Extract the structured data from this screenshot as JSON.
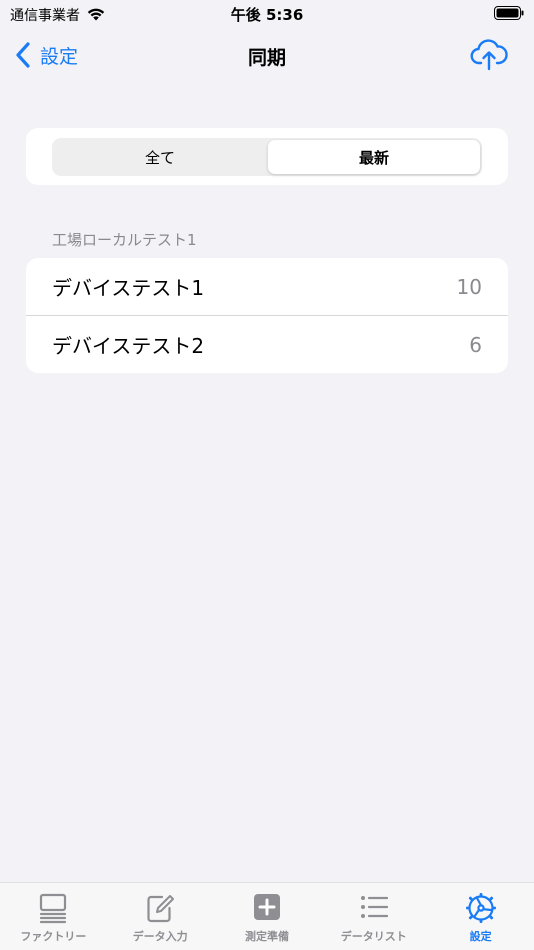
{
  "status_bar": {
    "carrier": "通信事業者",
    "time": "午後 5:36"
  },
  "nav": {
    "back_label": "設定",
    "title": "同期"
  },
  "segments": [
    {
      "label": "全て",
      "selected": false
    },
    {
      "label": "最新",
      "selected": true
    }
  ],
  "section": {
    "header": "工場ローカルテスト1",
    "rows": [
      {
        "label": "デバイステスト1",
        "count": "10"
      },
      {
        "label": "デバイステスト2",
        "count": "6"
      }
    ]
  },
  "tabs": [
    {
      "label": "ファクトリー",
      "icon": "factory-icon",
      "active": false
    },
    {
      "label": "データ入力",
      "icon": "edit-icon",
      "active": false
    },
    {
      "label": "測定準備",
      "icon": "plus-square-icon",
      "active": false
    },
    {
      "label": "データリスト",
      "icon": "list-icon",
      "active": false
    },
    {
      "label": "設定",
      "icon": "gear-icon",
      "active": true
    }
  ],
  "colors": {
    "accent": "#1a7cf5",
    "background": "#f2f2f7",
    "secondary_text": "#8a8a8e"
  }
}
